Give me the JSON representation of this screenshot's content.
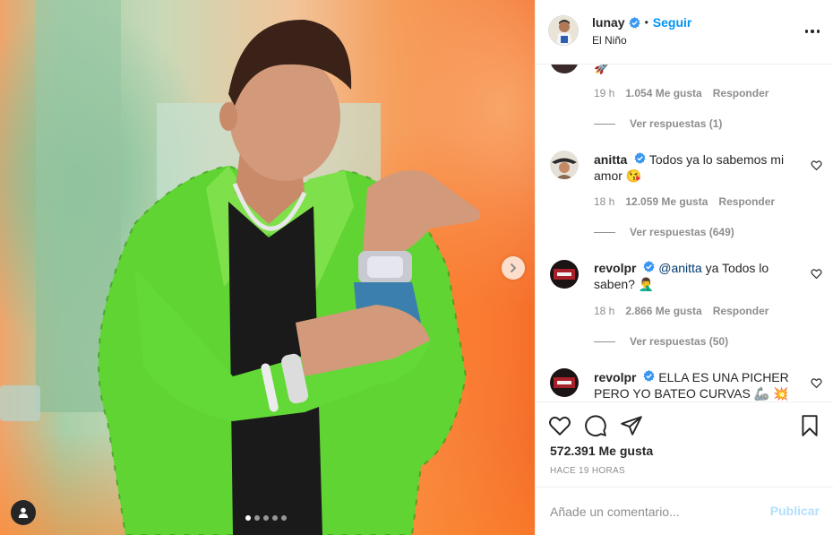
{
  "post": {
    "author": "lunay",
    "follow_label": "Seguir",
    "dot": "•",
    "subtitle": "El Niño",
    "carousel": {
      "slides": 5,
      "active": 1
    }
  },
  "comments": {
    "partial": {
      "emoji": "🚀",
      "time": "19 h",
      "likes": "1.054 Me gusta",
      "reply": "Responder",
      "replies": "Ver respuestas (1)"
    },
    "items": [
      {
        "user": "anitta",
        "text": "Todos ya lo sabemos mi amor",
        "emoji": "😘",
        "time": "18 h",
        "likes": "12.059 Me gusta",
        "reply": "Responder",
        "replies": "Ver respuestas (649)"
      },
      {
        "user": "revolpr",
        "mention": "@anitta",
        "text": "ya Todos lo saben?",
        "emoji": "🤦‍♂️",
        "time": "18 h",
        "likes": "2.866 Me gusta",
        "reply": "Responder",
        "replies": "Ver respuestas (50)"
      },
      {
        "user": "revolpr",
        "text": "ELLA ES UNA PICHER PERO YO BATEO CURVAS",
        "emoji": "🦾",
        "emoji2": "💥"
      }
    ]
  },
  "actions": {
    "likes": "572.391 Me gusta",
    "time_ago": "HACE 19 HORAS"
  },
  "composer": {
    "placeholder": "Añade un comentario...",
    "publish_label": "Publicar"
  },
  "colors": {
    "link_blue": "#0095f6",
    "verified_blue": "#3897f0",
    "muted": "#8e8e8e",
    "publish_disabled": "#b2dffc"
  }
}
